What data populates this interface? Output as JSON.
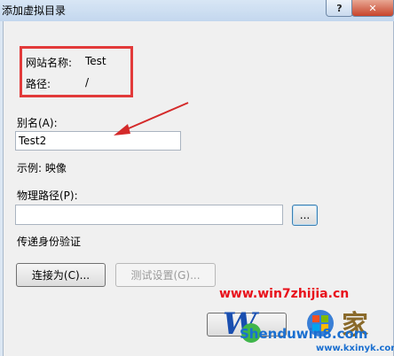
{
  "window": {
    "title": "添加虚拟目录",
    "help_label": "?",
    "close_label": "✕"
  },
  "site_info": {
    "site_name_label": "网站名称:",
    "site_name_value": "Test",
    "path_label": "路径:",
    "path_value": "/"
  },
  "alias": {
    "label": "别名(A):",
    "value": "Test2",
    "example": "示例: 映像"
  },
  "physical_path": {
    "label": "物理路径(P):",
    "value": "",
    "browse_label": "..."
  },
  "auth": {
    "label": "传递身份验证",
    "connect_as_label": "连接为(C)...",
    "test_settings_label": "测试设置(G)..."
  },
  "watermark": {
    "url1": "www.win7zhijia.cn",
    "url2": "Shenduwin8.com",
    "url3": "www.kxinyk.com"
  },
  "colors": {
    "highlight_box": "#e23a3a",
    "arrow": "#d42a2a",
    "watermark_red": "#e8101a",
    "watermark_blue": "#1a6fd0"
  }
}
